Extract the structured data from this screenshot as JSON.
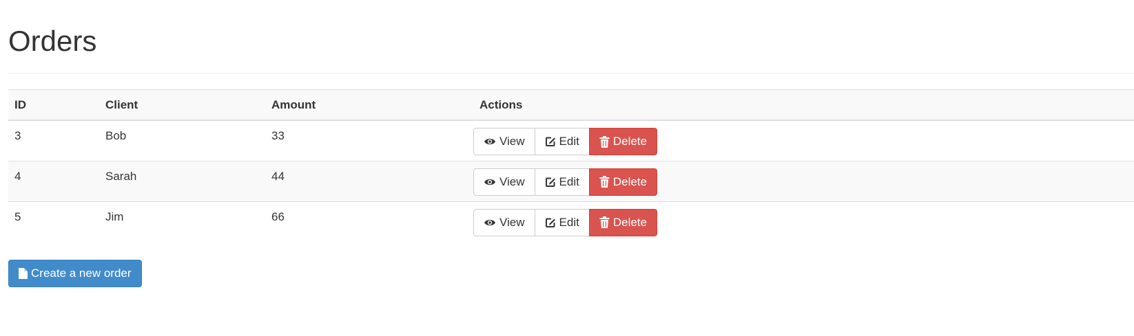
{
  "page": {
    "title": "Orders"
  },
  "table": {
    "headers": {
      "id": "ID",
      "client": "Client",
      "amount": "Amount",
      "actions": "Actions"
    },
    "rows": [
      {
        "id": "3",
        "client": "Bob",
        "amount": "33"
      },
      {
        "id": "4",
        "client": "Sarah",
        "amount": "44"
      },
      {
        "id": "5",
        "client": "Jim",
        "amount": "66"
      }
    ]
  },
  "actions": {
    "view_label": "View",
    "edit_label": "Edit",
    "delete_label": "Delete",
    "view_icon": "eye-icon",
    "edit_icon": "edit-icon",
    "delete_icon": "trash-icon"
  },
  "create_button": {
    "label": "Create a new order",
    "icon": "file-icon"
  },
  "colors": {
    "primary": "#428bca",
    "danger": "#d9534f",
    "text": "#333333",
    "stripe": "#f9f9f9",
    "border": "#dddddd"
  }
}
